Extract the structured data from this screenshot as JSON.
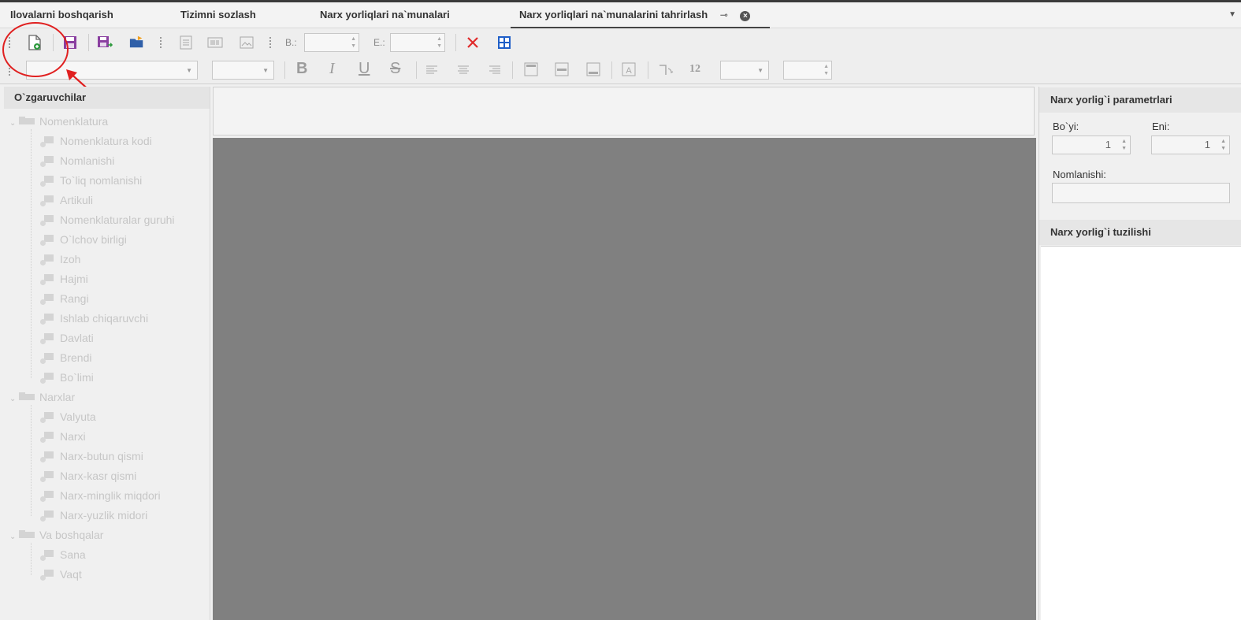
{
  "tabs": [
    {
      "label": "Ilovalarni boshqarish"
    },
    {
      "label": "Tizimni sozlash"
    },
    {
      "label": "Narx yorliqlari na`munalari"
    },
    {
      "label": "Narx yorliqlari na`munalarini tahrirlash"
    }
  ],
  "toolbar": {
    "b_label": "B.:",
    "e_label": "E.:",
    "font_size_number": "12"
  },
  "left_panel": {
    "title": "O`zgaruvchilar",
    "groups": [
      {
        "label": "Nomenklatura",
        "items": [
          "Nomenklatura kodi",
          "Nomlanishi",
          "To`liq nomlanishi",
          "Artikuli",
          "Nomenklaturalar guruhi",
          "O`lchov birligi",
          "Izoh",
          "Hajmi",
          "Rangi",
          "Ishlab chiqaruvchi",
          "Davlati",
          "Brendi",
          "Bo`limi"
        ]
      },
      {
        "label": "Narxlar",
        "items": [
          "Valyuta",
          "Narxi",
          "Narx-butun qismi",
          "Narx-kasr qismi",
          "Narx-minglik miqdori",
          "Narx-yuzlik midori"
        ]
      },
      {
        "label": "Va boshqalar",
        "items": [
          "Sana",
          "Vaqt"
        ]
      }
    ]
  },
  "right_panel": {
    "params_title": "Narx yorlig`i parametrlari",
    "height_label": "Bo`yi:",
    "height_value": "1",
    "width_label": "Eni:",
    "width_value": "1",
    "name_label": "Nomlanishi:",
    "name_value": "",
    "structure_title": "Narx yorlig`i tuzilishi"
  },
  "colors": {
    "canvas": "#808080",
    "annotation": "#e02020",
    "delete_icon": "#e02a2a",
    "grid_icon": "#1f5fc8",
    "save_icon": "#8a3fa0"
  }
}
